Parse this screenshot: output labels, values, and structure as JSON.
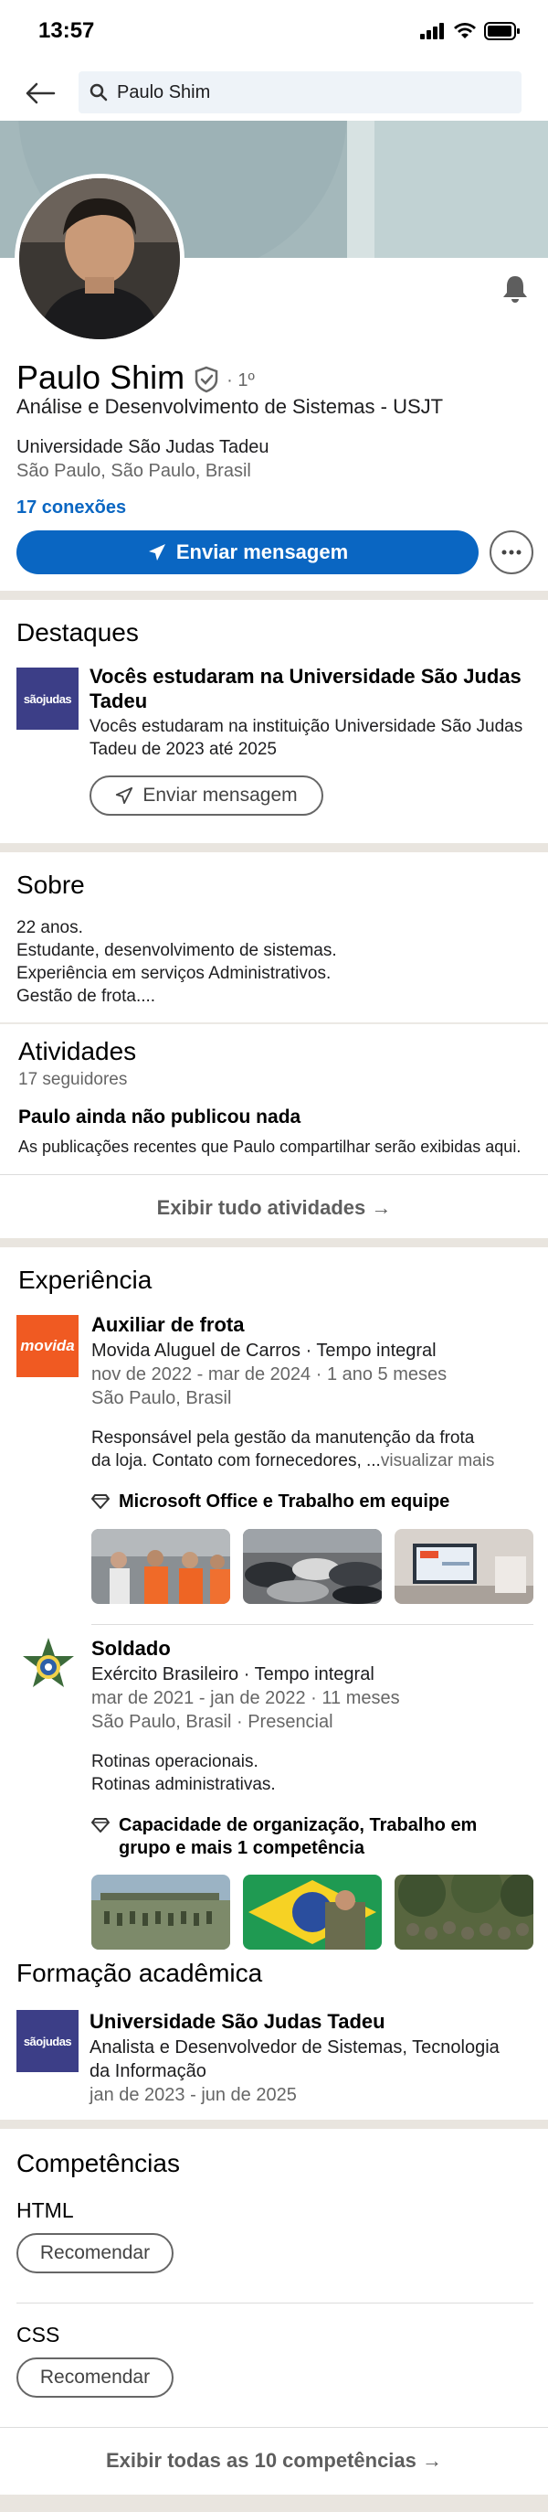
{
  "status": {
    "time": "13:57"
  },
  "search": {
    "value": "Paulo Shim"
  },
  "profile": {
    "name": "Paulo Shim",
    "degree": "· 1º",
    "headline": "Análise e Desenvolvimento de Sistemas - USJT",
    "school": "Universidade São Judas Tadeu",
    "location": "São Paulo, São Paulo, Brasil",
    "connections": "17 conexões",
    "message_button": "Enviar mensagem"
  },
  "highlights": {
    "title": "Destaques",
    "logo_text": "sãojudas",
    "item_title": "Vocês estudaram na Universidade São Judas Tadeu",
    "item_text": "Vocês estudaram na instituição Universidade São Judas Tadeu de 2023 até 2025",
    "button": "Enviar mensagem"
  },
  "about": {
    "title": "Sobre",
    "lines": [
      "22 anos.",
      "Estudante, desenvolvimento de sistemas.",
      "Experiência em serviços Administrativos.",
      "Gestão de frota...."
    ]
  },
  "activity": {
    "title": "Atividades",
    "followers": "17 seguidores",
    "empty_title": "Paulo ainda não publicou nada",
    "empty_desc": "As publicações recentes que Paulo compartilhar serão exibidas aqui.",
    "show_all": "Exibir tudo atividades →"
  },
  "experience": {
    "title": "Experiência",
    "jobs": [
      {
        "logo_text": "movida",
        "title": "Auxiliar de frota",
        "company": "Movida Aluguel de Carros · Tempo integral",
        "dates": "nov de 2022 - mar de 2024 · 1 ano 5 meses",
        "location": "São Paulo, Brasil",
        "desc_line1": "Responsável pela gestão da manutenção da frota",
        "desc_line2": "da loja. Contato com fornecedores, ...",
        "see_more": "visualizar mais",
        "skills": "Microsoft Office e Trabalho em equipe"
      },
      {
        "title": "Soldado",
        "company": "Exército Brasileiro · Tempo integral",
        "dates": "mar de 2021 - jan de 2022 · 11 meses",
        "location": "São Paulo, Brasil · Presencial",
        "desc_line1": "Rotinas operacionais.",
        "desc_line2": "Rotinas administrativas.",
        "skills_line1": "Capacidade de organização, Trabalho em",
        "skills_line2": "grupo e mais 1 competência"
      }
    ]
  },
  "education": {
    "title": "Formação acadêmica",
    "school": "Universidade São Judas Tadeu",
    "degree_line1": "Analista e Desenvolvedor de Sistemas, Tecnologia",
    "degree_line2": "da Informação",
    "dates": "jan de 2023 - jun de 2025"
  },
  "skills": {
    "title": "Competências",
    "items": [
      {
        "name": "HTML",
        "button": "Recomendar"
      },
      {
        "name": "CSS",
        "button": "Recomendar"
      }
    ],
    "show_all": "Exibir todas as 10 competências →"
  },
  "colors": {
    "primary": "#0a66c2",
    "divider": "#e9e5df",
    "movida": "#f05a22",
    "usjt": "#3c3e87"
  }
}
